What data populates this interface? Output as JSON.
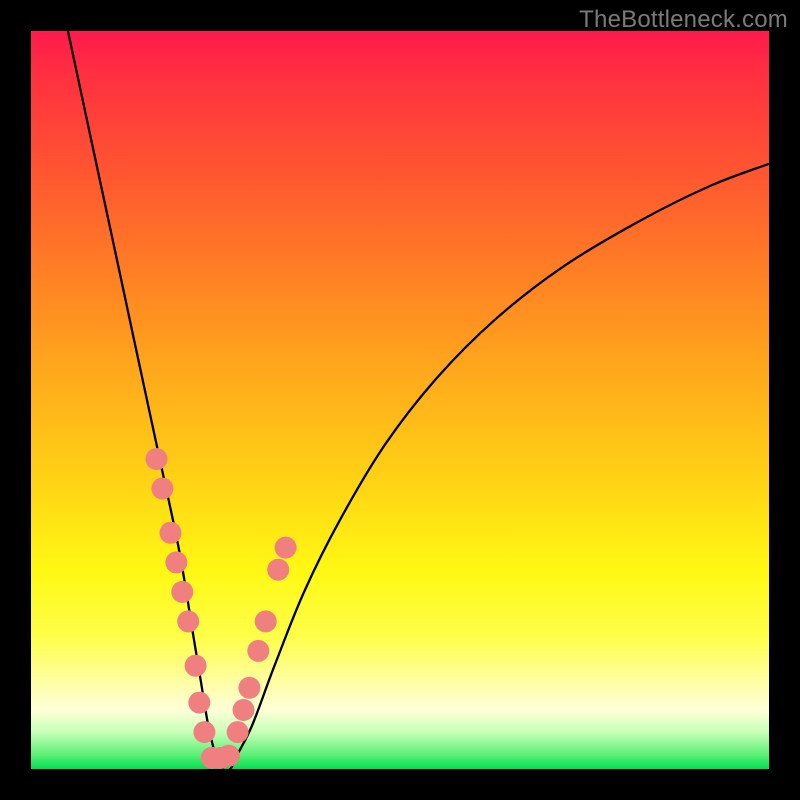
{
  "watermark": "TheBottleneck.com",
  "colors": {
    "dot": "#f08080",
    "curve": "#000000",
    "frame": "#000000"
  },
  "chart_data": {
    "type": "line",
    "title": "",
    "xlabel": "",
    "ylabel": "",
    "xlim": [
      0,
      100
    ],
    "ylim": [
      0,
      100
    ],
    "grid": false,
    "series": [
      {
        "name": "bottleneck-curve",
        "x": [
          5,
          8,
          11,
          14,
          17,
          20,
          22,
          23,
          24,
          25,
          26,
          27,
          28,
          30,
          33,
          37,
          42,
          48,
          55,
          63,
          72,
          82,
          92,
          100
        ],
        "y": [
          100,
          86,
          72,
          58,
          44,
          30,
          18,
          12,
          6,
          2,
          0,
          0,
          2,
          6,
          14,
          24,
          34,
          44,
          53,
          61,
          68,
          74,
          79,
          82
        ]
      }
    ],
    "scatter_points": {
      "name": "highlighted-points",
      "x": [
        17.0,
        17.8,
        18.9,
        19.7,
        20.5,
        21.3,
        22.3,
        22.8,
        23.5,
        24.5,
        25.7,
        26.8,
        28.0,
        28.8,
        29.6,
        30.8,
        31.8,
        33.5,
        34.5
      ],
      "y": [
        42.0,
        38.0,
        32.0,
        28.0,
        24.0,
        20.0,
        14.0,
        9.0,
        5.0,
        1.5,
        1.5,
        1.8,
        5.0,
        8.0,
        11.0,
        16.0,
        20.0,
        27.0,
        30.0
      ]
    }
  }
}
